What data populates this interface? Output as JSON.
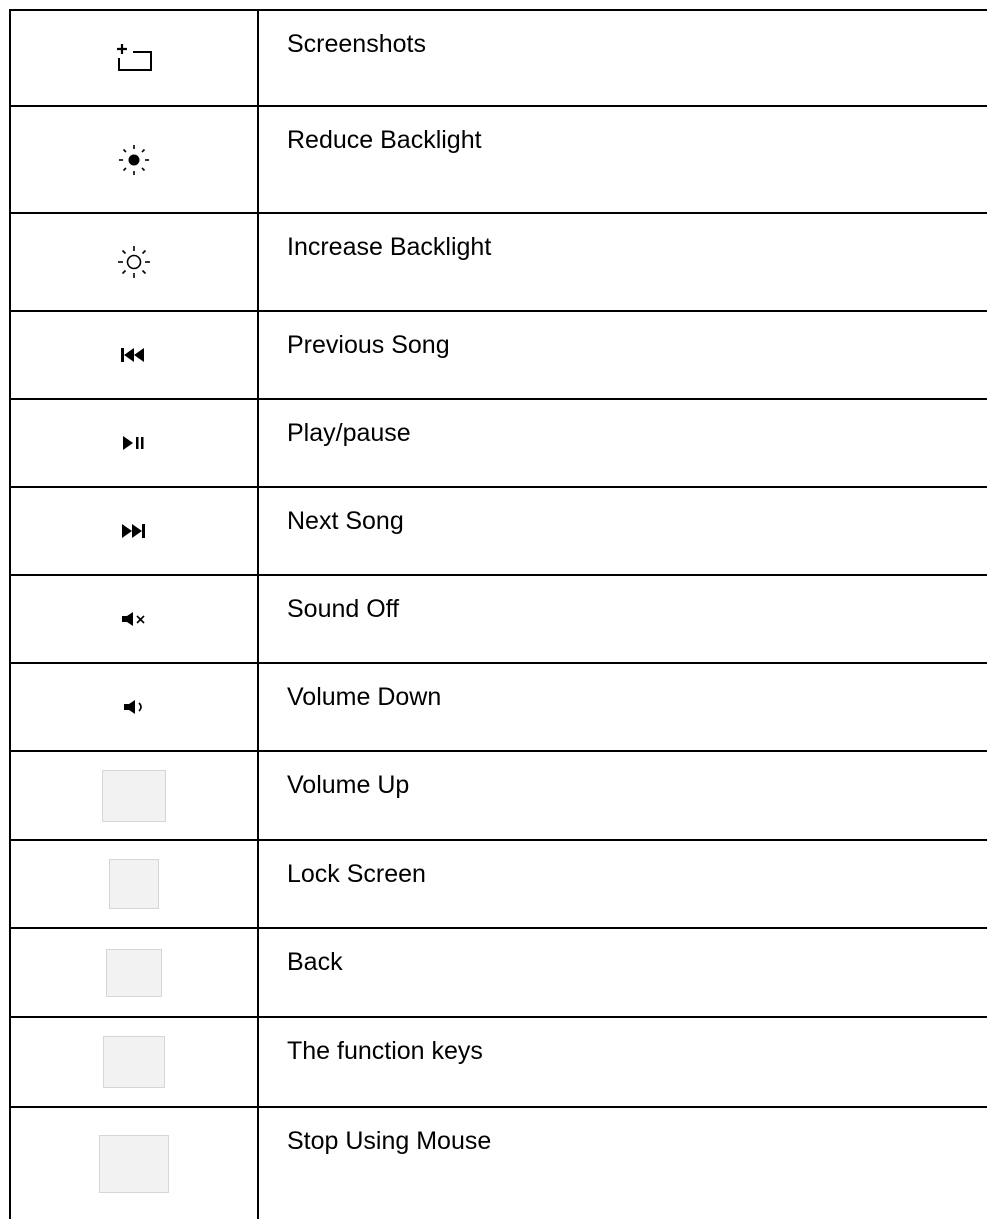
{
  "table": {
    "rows": [
      {
        "icon": "screenshot-icon",
        "label": "Screenshots"
      },
      {
        "icon": "reduce-backlight-icon",
        "label": "Reduce Backlight"
      },
      {
        "icon": "increase-backlight-icon",
        "label": "Increase Backlight"
      },
      {
        "icon": "previous-song-icon",
        "label": "Previous Song"
      },
      {
        "icon": "play-pause-icon",
        "label": "Play/pause"
      },
      {
        "icon": "next-song-icon",
        "label": "Next Song"
      },
      {
        "icon": "sound-off-icon",
        "label": "Sound Off"
      },
      {
        "icon": "volume-down-icon",
        "label": "Volume Down"
      },
      {
        "icon": "blank-key-icon",
        "label": "Volume Up"
      },
      {
        "icon": "blank-key-icon",
        "label": "Lock Screen"
      },
      {
        "icon": "blank-key-icon",
        "label": "Back"
      },
      {
        "icon": "blank-key-icon",
        "label": "The function keys"
      },
      {
        "icon": "blank-key-icon",
        "label": "Stop Using Mouse"
      }
    ]
  },
  "colors": {
    "border": "#000000",
    "icon": "#000000",
    "placeholder_fill": "#f2f2f2",
    "placeholder_border": "#d6d6d6"
  }
}
